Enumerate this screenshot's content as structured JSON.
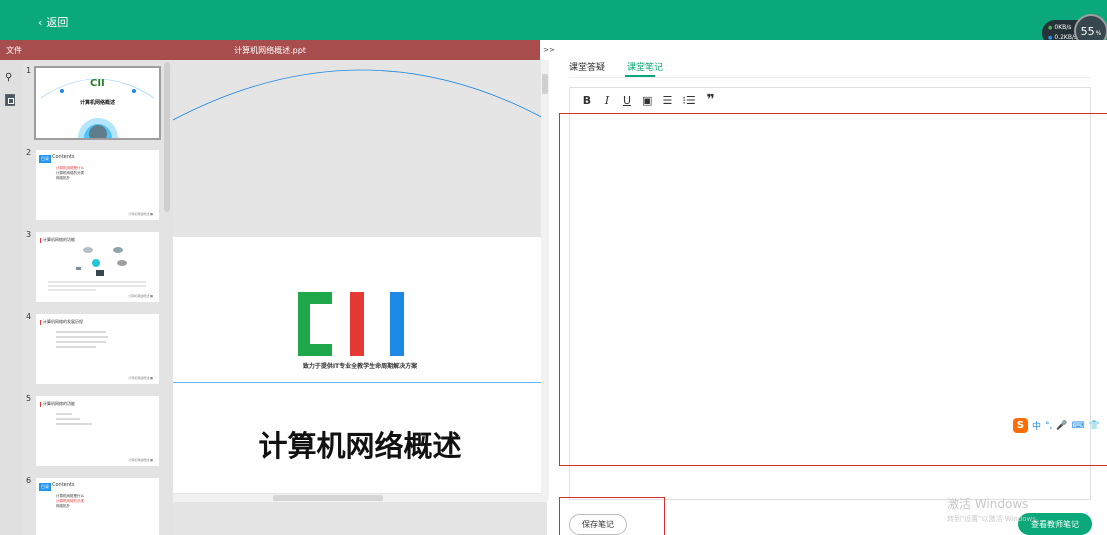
{
  "topbar": {
    "back_label": "返回",
    "net": {
      "up": "0KB/s",
      "down": "0.2KB/s",
      "cpu_pct": "55",
      "cpu_unit": "%"
    }
  },
  "presentation": {
    "file_label": "文件",
    "file_name": "计算机网络概述.ppt",
    "collapse_label": ">>",
    "slide": {
      "logo_text": "CII",
      "slogan": "致力于提供IT专业全教学生命周期解决方案",
      "title": "计算机网络概述"
    },
    "thumbnails": [
      {
        "num": "1",
        "title": "计算机网络概述",
        "logo": "CII"
      },
      {
        "num": "2",
        "tag": "目录",
        "heading": "Contents",
        "items": [
          "计算机网络是什么",
          "计算机网络的分类",
          "网络拓扑"
        ],
        "foot": "计算机网络概述 ■"
      },
      {
        "num": "3",
        "title": "计算机网络的功能",
        "foot": "计算机网络概述 ■"
      },
      {
        "num": "4",
        "title": "计算机网络的发展历程",
        "foot": "计算机网络概述 ■"
      },
      {
        "num": "5",
        "title": "计算机网络的功能",
        "foot": "计算机网络概述 ■"
      },
      {
        "num": "6",
        "tag": "目录",
        "heading": "Contents",
        "items": [
          "计算机网络是什么",
          "计算机网络的分类",
          "网络拓扑"
        ]
      }
    ]
  },
  "notes": {
    "tabs": [
      "课堂答疑",
      "课堂笔记"
    ],
    "active_tab": "课堂笔记",
    "toolbar": {
      "bold": "B",
      "italic": "I",
      "underline": "U",
      "image": "▣",
      "bullet": "☰",
      "numbered": "⁝☰",
      "quote": "❞"
    },
    "save_label": "保存笔记",
    "teacher_label": "查看教师笔记"
  },
  "ime": {
    "lang": "中",
    "punct": "°,",
    "mic": "🎤",
    "keyboard": "⌨",
    "skin": "👕"
  },
  "watermark": {
    "line1": "激活 Windows",
    "line2": "转到\"设置\"以激活 Windows。"
  },
  "colors": {
    "brand_green": "#0aa87a",
    "header_red": "#a84d4d",
    "highlight_red": "#d32f2f"
  }
}
